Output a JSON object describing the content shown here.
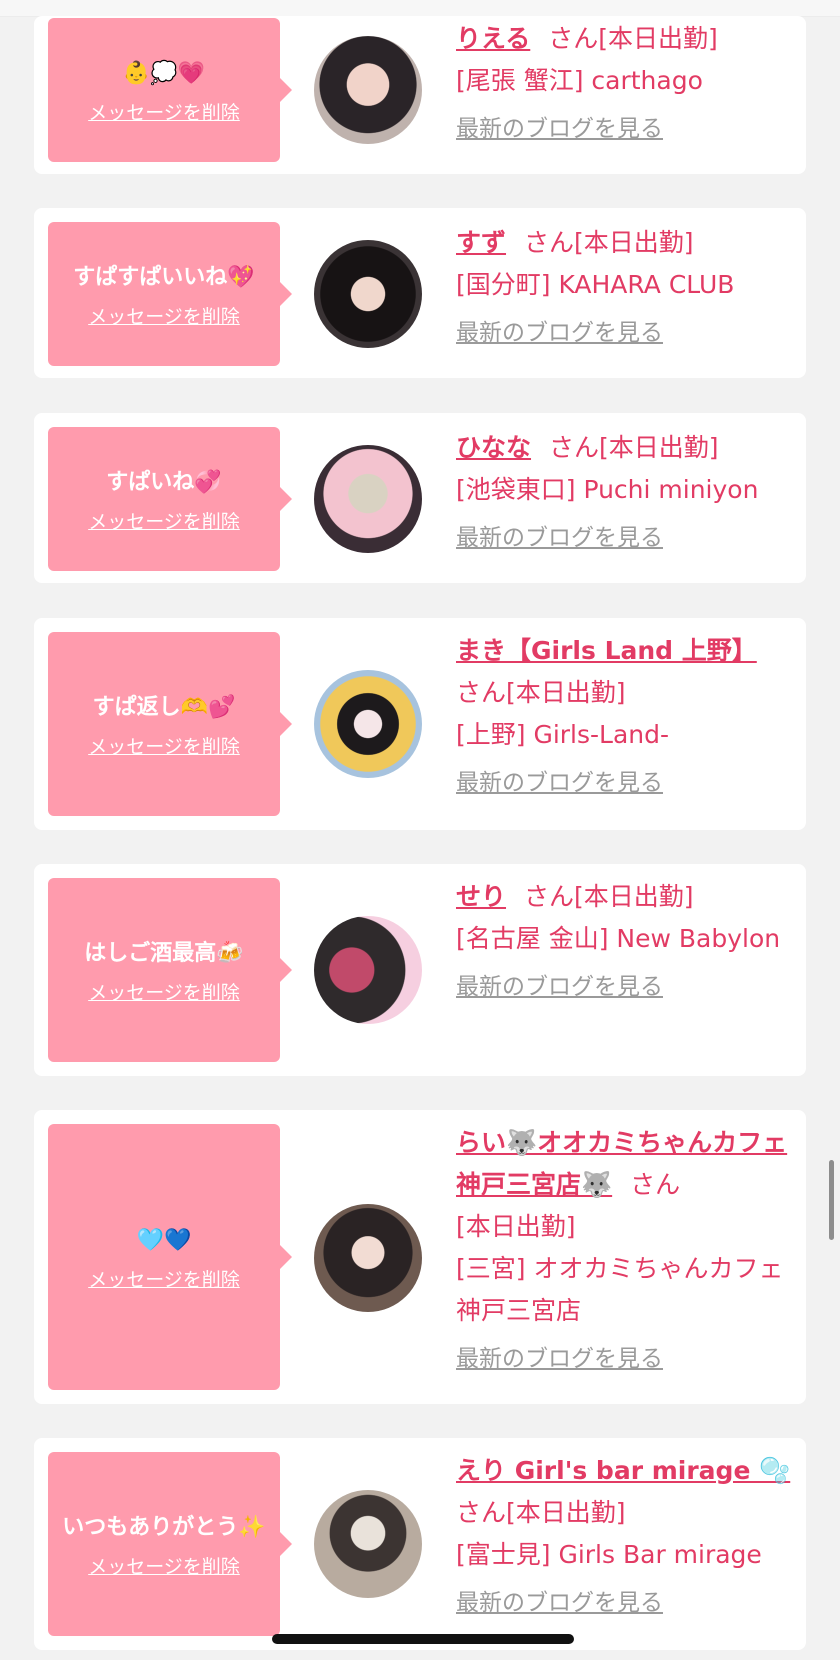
{
  "colors": {
    "accent": "#e23b64",
    "bubble": "#ff9bad",
    "link_gray": "#9a9a9a",
    "background": "#f2f2f2"
  },
  "delete_label": "メッセージを削除",
  "blog_label": "最新のブログを見る",
  "san_label": "さん",
  "cards": [
    {
      "message": "👶💭💗",
      "name": "りえる",
      "status": "[本日出勤]",
      "shop": "[尾張 蟹江] carthago",
      "avatar": "avatar-photo"
    },
    {
      "message": "すぱすぱいいね💖",
      "name": "すず",
      "status": "[本日出勤]",
      "shop": "[国分町] KAHARA CLUB",
      "avatar": "avatar-photo"
    },
    {
      "message": "すぱいね💞",
      "name": "ひなな",
      "status": "[本日出勤]",
      "shop": "[池袋東口] Puchi miniyon",
      "avatar": "avatar-photo"
    },
    {
      "message": "すぱ返し🫶💕",
      "name": "まき【Girls Land 上野】",
      "status": "[本日出勤]",
      "shop": "[上野] Girls-Land-",
      "avatar": "avatar-photo"
    },
    {
      "message": "はしご酒最高🍻",
      "name": "せり",
      "status": "[本日出勤]",
      "shop": "[名古屋 金山] New Babylon",
      "avatar": "avatar-photo"
    },
    {
      "message": "🩵💙",
      "name": "らい🐺オオカミちゃんカフェ神戸三宮店🐺",
      "status": "[本日出勤]",
      "shop": "[三宮] オオカミちゃんカフェ神戸三宮店",
      "avatar": "avatar-photo"
    },
    {
      "message": "いつもありがとう✨",
      "name": "えり Girl's bar mirage 🫧",
      "status": "[本日出勤]",
      "shop": "[富士見] Girls Bar mirage",
      "avatar": "avatar-photo"
    }
  ]
}
